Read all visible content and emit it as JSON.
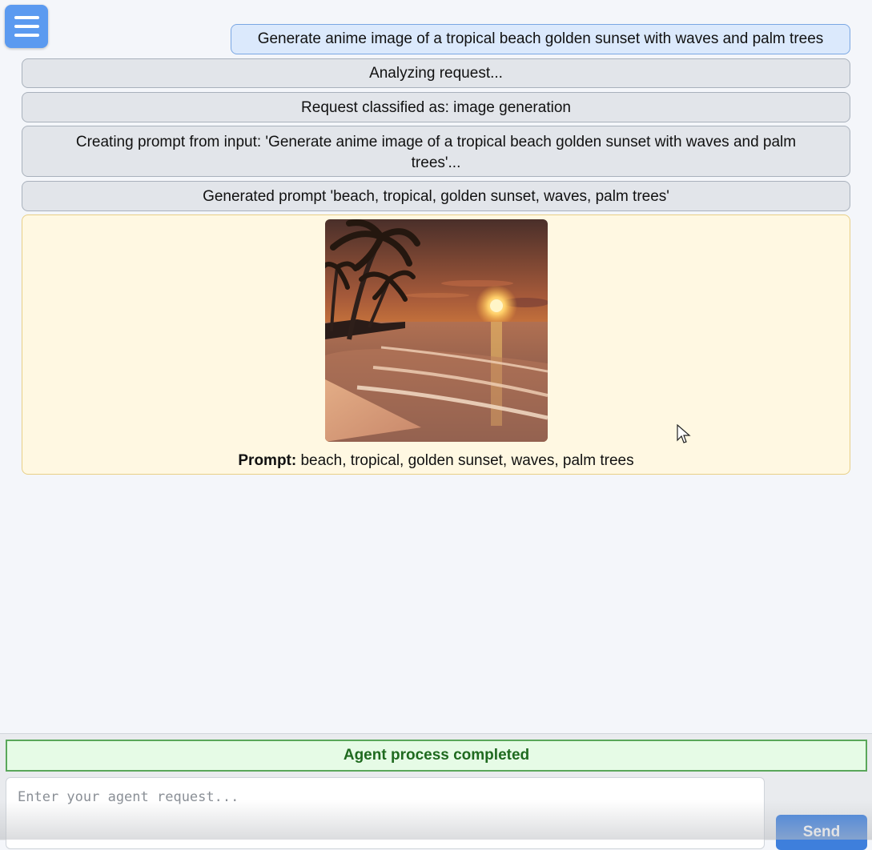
{
  "menu": {
    "icon": "hamburger-menu-icon"
  },
  "chat": {
    "user_message": "Generate anime image of a tropical beach golden sunset with waves and palm trees",
    "status_messages": [
      "Analyzing request...",
      "Request classified as: image generation",
      "Creating prompt from input: 'Generate anime image of a tropical beach golden sunset with waves and palm trees'...",
      "Generated prompt 'beach, tropical, golden sunset, waves, palm trees'"
    ],
    "result": {
      "prompt_label": "Prompt:",
      "prompt_value": "beach, tropical, golden sunset, waves, palm trees"
    }
  },
  "footer": {
    "status_text": "Agent process completed",
    "input_placeholder": "Enter your agent request...",
    "send_label": "Send"
  },
  "colors": {
    "accent": "#3e7fdc",
    "success": "#1f6a1f",
    "result_bg": "#fff8e2"
  }
}
